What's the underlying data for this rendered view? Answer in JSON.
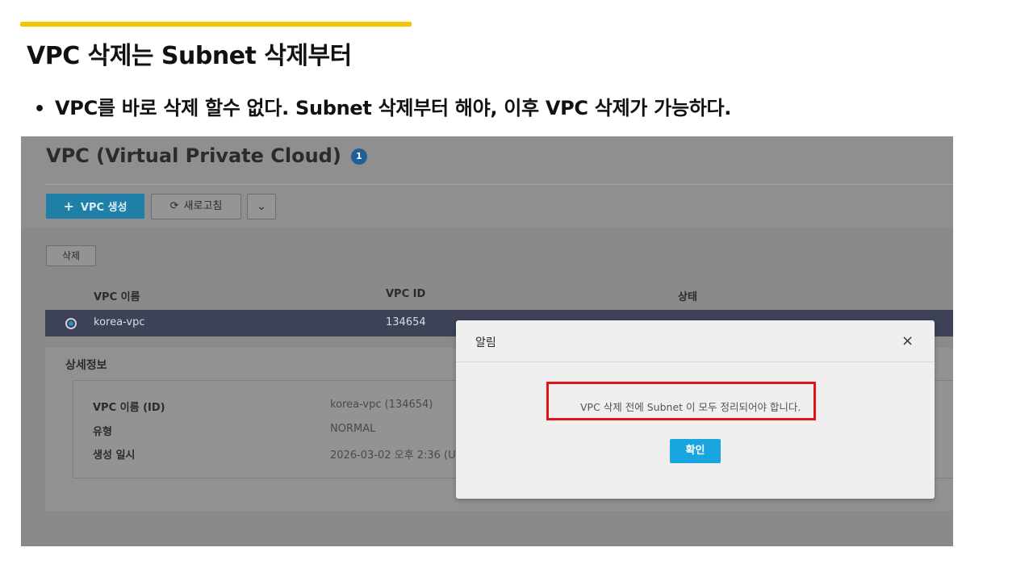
{
  "slide": {
    "title": "VPC 삭제는 Subnet 삭제부터",
    "bullet_symbol": "•",
    "bullet": "VPC를 바로 삭제 할수 없다. Subnet 삭제부터 해야, 이후 VPC 삭제가 가능하다."
  },
  "console": {
    "title": "VPC (Virtual Private Cloud)",
    "count": "1",
    "toolbar": {
      "create_icon": "+",
      "create_label": "VPC 생성",
      "refresh_icon": "⟳",
      "refresh_label": "새로고침",
      "more_icon": "⌄"
    },
    "delete_label": "삭제",
    "table": {
      "columns": [
        "VPC 이름",
        "VPC ID",
        "상태"
      ],
      "rows": [
        {
          "name": "korea-vpc",
          "id": "134654"
        }
      ]
    },
    "details": {
      "title": "상세정보",
      "items": [
        {
          "label": "VPC 이름 (ID)",
          "value": "korea-vpc (134654)"
        },
        {
          "label": "유형",
          "value": "NORMAL"
        },
        {
          "label": "생성 일시",
          "value": "2026-03-02 오후 2:36 (UT"
        }
      ]
    }
  },
  "modal": {
    "title": "알림",
    "close_icon": "×",
    "message": "VPC 삭제 전에 Subnet 이 모두 정리되어야 합니다.",
    "ok_label": "확인"
  },
  "colors": {
    "accent_bar": "#f5c400",
    "primary_button": "#19a6e0",
    "highlight_border": "#e4141b",
    "selected_row": "#3e4256"
  }
}
